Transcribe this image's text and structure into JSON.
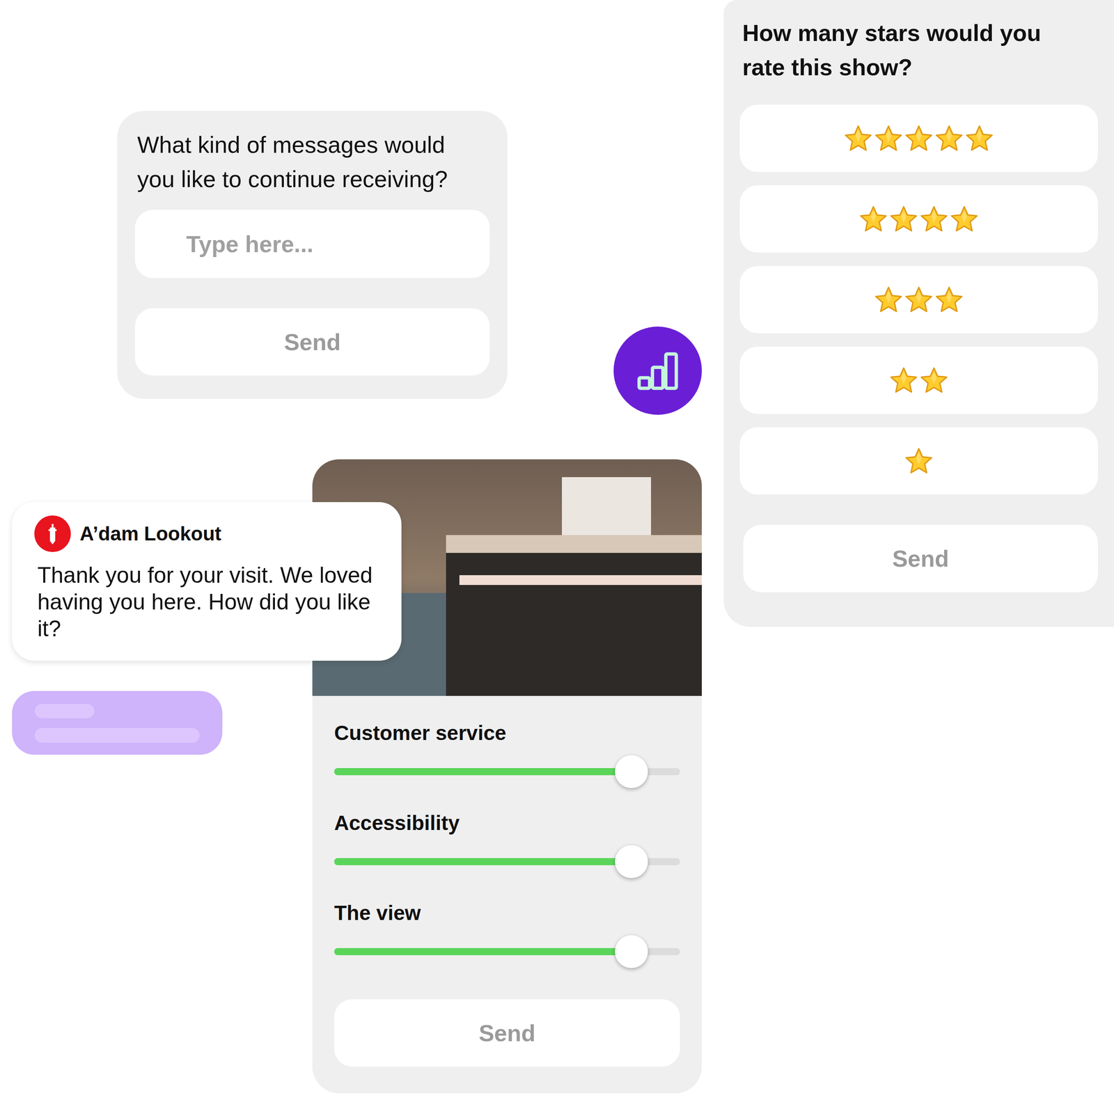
{
  "message_card": {
    "question": "What kind of messages would you like to continue receiving?",
    "input": {
      "placeholder": "Type here..."
    },
    "send": "Send"
  },
  "rating_card": {
    "question": "How many stars would you rate this show?",
    "options": [
      {
        "stars": 5,
        "selected": false
      },
      {
        "stars": 4,
        "selected": false
      },
      {
        "stars": 3,
        "selected": false
      },
      {
        "stars": 2,
        "selected": false
      },
      {
        "stars": 1,
        "selected": false
      }
    ],
    "send": "Send"
  },
  "visit_card": {
    "notification": {
      "sender": "A’dam Lookout",
      "message": "Thank you for your visit. We loved having you here. How did you like it?"
    },
    "sliders": [
      {
        "label": "Customer service",
        "level": 0.86
      },
      {
        "label": "Accessibility",
        "level": 0.86
      },
      {
        "label": "The view",
        "level": 0.86
      }
    ],
    "send": "Send"
  }
}
